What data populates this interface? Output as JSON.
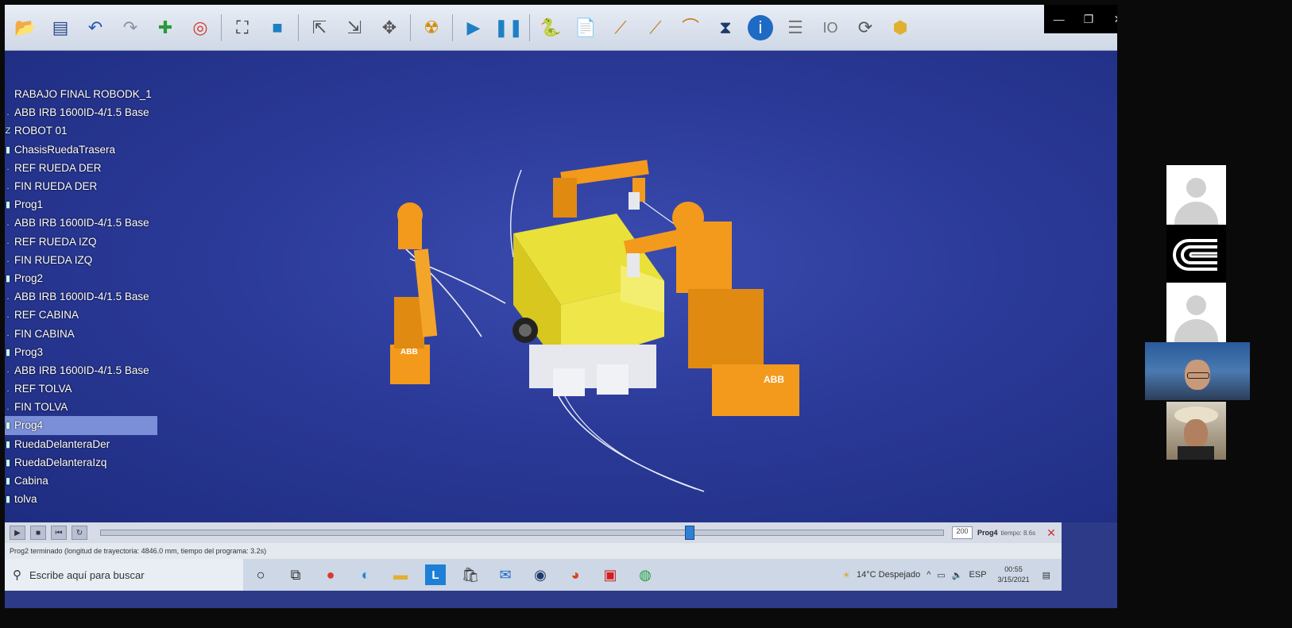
{
  "window": {
    "minimize": "—",
    "restore": "❐",
    "close": "✕"
  },
  "toolbar": {
    "icons": [
      "open-icon",
      "save-icon",
      "undo-icon",
      "redo-icon",
      "add-target-icon",
      "target-icon",
      "fit-view-icon",
      "cube-icon",
      "select-icon",
      "select-add-icon",
      "select-move-icon",
      "collision-icon",
      "play-icon",
      "pause-icon",
      "python-icon",
      "new-program-icon",
      "move-joint-icon",
      "move-linear-icon",
      "move-circular-icon",
      "wait-icon",
      "info-icon",
      "report-icon",
      "io-icon",
      "sync-icon",
      "settings-icon"
    ]
  },
  "tree": {
    "items": [
      {
        "label": "RABAJO FINAL ROBODK_1",
        "bullet": ""
      },
      {
        "label": "ABB IRB 1600ID-4/1.5 Base",
        "bullet": "."
      },
      {
        "label": "ROBOT 01",
        "bullet": "Z"
      },
      {
        "label": "ChasisRuedaTrasera",
        "bullet": "▮"
      },
      {
        "label": "REF RUEDA DER",
        "bullet": "."
      },
      {
        "label": "FIN RUEDA DER",
        "bullet": "."
      },
      {
        "label": "Prog1",
        "bullet": "▮"
      },
      {
        "label": "ABB IRB 1600ID-4/1.5 Base",
        "bullet": "."
      },
      {
        "label": "REF RUEDA IZQ",
        "bullet": "."
      },
      {
        "label": "FIN RUEDA IZQ",
        "bullet": "."
      },
      {
        "label": "Prog2",
        "bullet": "▮"
      },
      {
        "label": "ABB IRB 1600ID-4/1.5 Base",
        "bullet": "."
      },
      {
        "label": "REF CABINA",
        "bullet": "."
      },
      {
        "label": "FIN CABINA",
        "bullet": "."
      },
      {
        "label": "Prog3",
        "bullet": "▮"
      },
      {
        "label": "ABB IRB 1600ID-4/1.5 Base",
        "bullet": "."
      },
      {
        "label": "REF TOLVA",
        "bullet": "."
      },
      {
        "label": "FIN TOLVA",
        "bullet": "."
      },
      {
        "label": "Prog4",
        "bullet": "▮",
        "selected": true
      },
      {
        "label": "RuedaDelanteraDer",
        "bullet": "▮"
      },
      {
        "label": "RuedaDelanteraIzq",
        "bullet": "▮"
      },
      {
        "label": "Cabina",
        "bullet": "▮"
      },
      {
        "label": "tolva",
        "bullet": "▮"
      }
    ]
  },
  "scene": {
    "robot_label": "ABB"
  },
  "timeline": {
    "buttons": [
      "▶",
      "■",
      "⏮",
      "↻"
    ],
    "progress": 0.7,
    "speed": "200",
    "program": "Prog4",
    "time_label": "tiempo: 8.6s"
  },
  "status": {
    "text": "Prog2 terminado (longitud de trayectoria: 4846.0 mm, tiempo del programa: 3.2s)"
  },
  "taskbar": {
    "search_placeholder": "Escribe aquí para buscar",
    "apps": [
      "cortana-icon",
      "task-view-icon",
      "chrome-icon",
      "edge-icon",
      "file-explorer-icon",
      "l-app-icon",
      "store-icon",
      "outlook-icon",
      "steam-icon",
      "powerpoint-icon",
      "acrobat-icon",
      "whatsapp-icon"
    ],
    "weather": "14°C  Despejado",
    "lang": "ESP",
    "time": "00:55",
    "date": "3/15/2021"
  },
  "colors": {
    "viewport": "#2b3a98",
    "robot": "#f39a1c",
    "truck": "#f0e62a"
  }
}
